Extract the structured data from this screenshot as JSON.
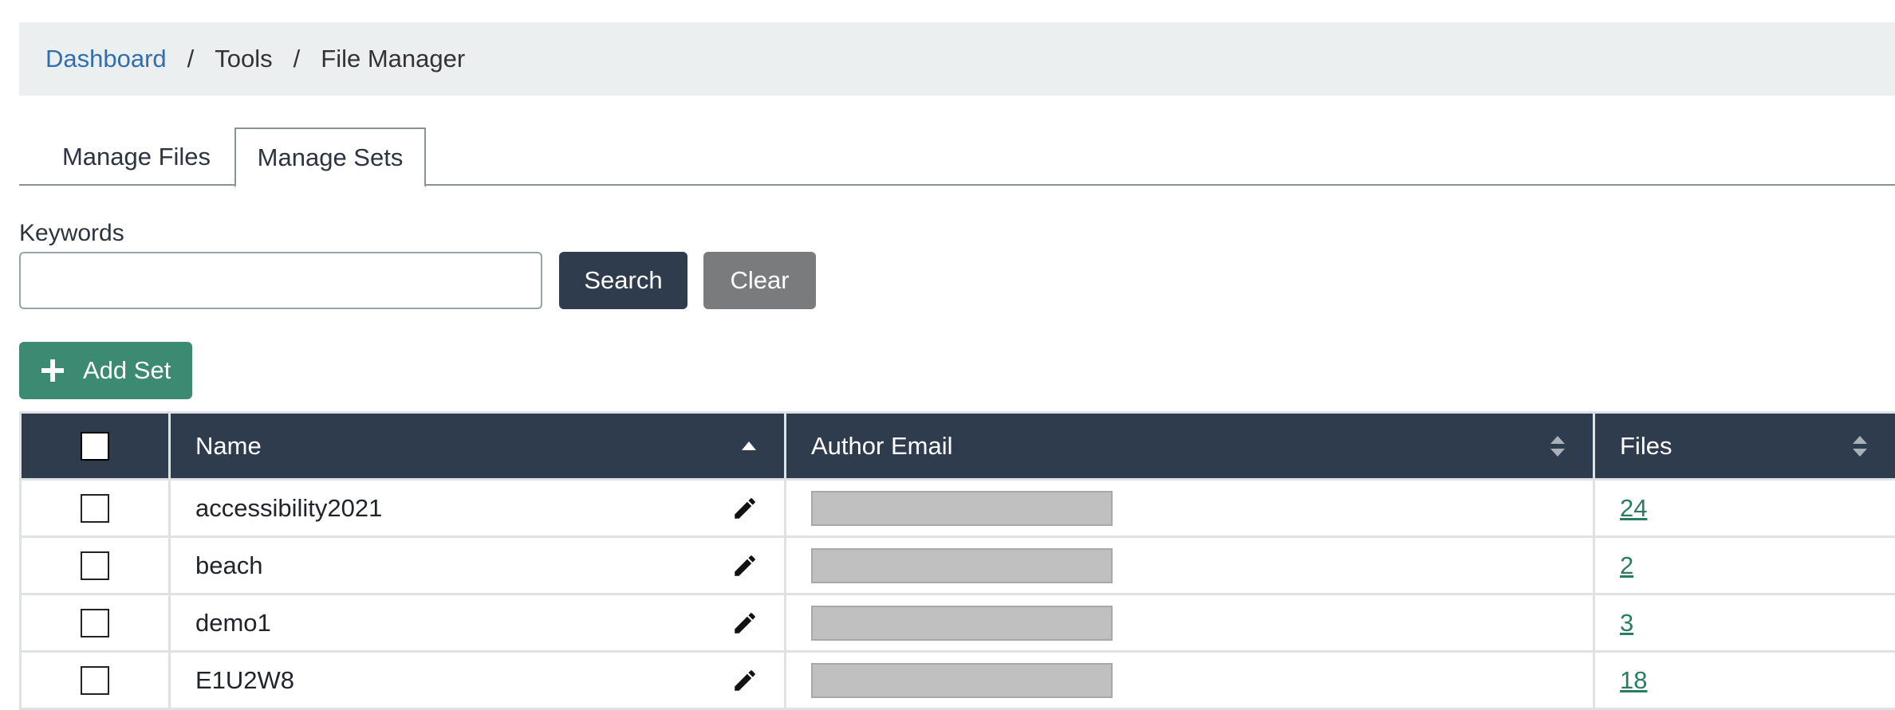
{
  "breadcrumb": {
    "items": [
      "Dashboard",
      "Tools",
      "File Manager"
    ],
    "separator": "/"
  },
  "tabs": [
    {
      "label": "Manage Files",
      "active": false
    },
    {
      "label": "Manage Sets",
      "active": true
    }
  ],
  "search": {
    "label": "Keywords",
    "value": "",
    "search_button": "Search",
    "clear_button": "Clear"
  },
  "add_button": {
    "label": "Add Set",
    "icon": "plus-icon"
  },
  "table": {
    "columns": [
      "",
      "Name",
      "Author Email",
      "Files"
    ],
    "rows": [
      {
        "name": "accessibility2021",
        "files": "24"
      },
      {
        "name": "beach",
        "files": "2"
      },
      {
        "name": "demo1",
        "files": "3"
      },
      {
        "name": "E1U2W8",
        "files": "18"
      }
    ]
  },
  "colors": {
    "header_bg": "#2f3c4e",
    "add_button": "#3c8a72",
    "link": "#2f6fb0",
    "files_link": "#2a7d63"
  }
}
